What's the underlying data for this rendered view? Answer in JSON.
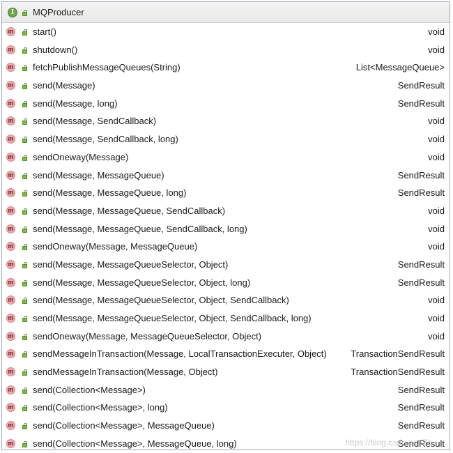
{
  "header": {
    "title": "MQProducer",
    "interface_badge": "I",
    "interface_icon": "interface-icon"
  },
  "method_badge": "m",
  "methods": [
    {
      "signature": "start()",
      "return": "void"
    },
    {
      "signature": "shutdown()",
      "return": "void"
    },
    {
      "signature": "fetchPublishMessageQueues(String)",
      "return": "List<MessageQueue>"
    },
    {
      "signature": "send(Message)",
      "return": "SendResult"
    },
    {
      "signature": "send(Message, long)",
      "return": "SendResult"
    },
    {
      "signature": "send(Message, SendCallback)",
      "return": "void"
    },
    {
      "signature": "send(Message, SendCallback, long)",
      "return": "void"
    },
    {
      "signature": "sendOneway(Message)",
      "return": "void"
    },
    {
      "signature": "send(Message, MessageQueue)",
      "return": "SendResult"
    },
    {
      "signature": "send(Message, MessageQueue, long)",
      "return": "SendResult"
    },
    {
      "signature": "send(Message, MessageQueue, SendCallback)",
      "return": "void"
    },
    {
      "signature": "send(Message, MessageQueue, SendCallback, long)",
      "return": "void"
    },
    {
      "signature": "sendOneway(Message, MessageQueue)",
      "return": "void"
    },
    {
      "signature": "send(Message, MessageQueueSelector, Object)",
      "return": "SendResult"
    },
    {
      "signature": "send(Message, MessageQueueSelector, Object, long)",
      "return": "SendResult"
    },
    {
      "signature": "send(Message, MessageQueueSelector, Object, SendCallback)",
      "return": "void"
    },
    {
      "signature": "send(Message, MessageQueueSelector, Object, SendCallback, long)",
      "return": "void"
    },
    {
      "signature": "sendOneway(Message, MessageQueueSelector, Object)",
      "return": "void"
    },
    {
      "signature": "sendMessageInTransaction(Message, LocalTransactionExecuter, Object)",
      "return": "TransactionSendResult"
    },
    {
      "signature": "sendMessageInTransaction(Message, Object)",
      "return": "TransactionSendResult"
    },
    {
      "signature": "send(Collection<Message>)",
      "return": "SendResult"
    },
    {
      "signature": "send(Collection<Message>, long)",
      "return": "SendResult"
    },
    {
      "signature": "send(Collection<Message>, MessageQueue)",
      "return": "SendResult"
    },
    {
      "signature": "send(Collection<Message>, MessageQueue, long)",
      "return": "SendResult"
    }
  ],
  "watermark": "https://blog.csdn.net/Zh..."
}
